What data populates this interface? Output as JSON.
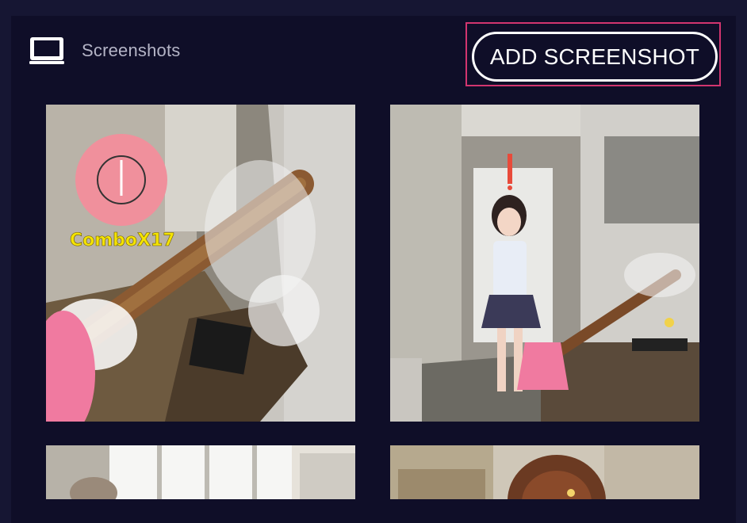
{
  "header": {
    "icon": "laptop-icon",
    "title": "Screenshots"
  },
  "actions": {
    "add_screenshot_label": "ADD SCREENSHOT"
  },
  "colors": {
    "page_background": "#161633",
    "panel_background": "#0f0e28",
    "highlight_border": "#d2356f",
    "button_border": "#ffffff"
  },
  "screenshots": [
    {
      "overlay_text": "ComboX17"
    },
    {
      "overlay_text": ""
    },
    {
      "overlay_text": ""
    },
    {
      "overlay_text": ""
    }
  ]
}
